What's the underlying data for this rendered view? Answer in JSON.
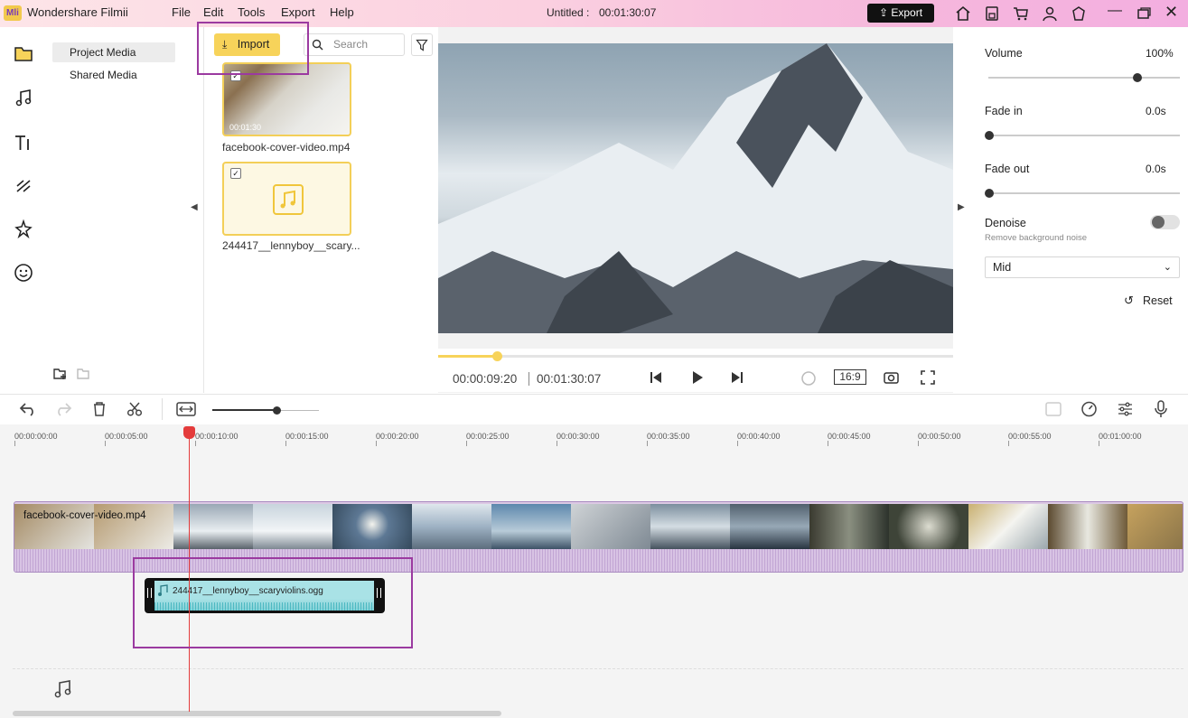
{
  "app": {
    "title": "Wondershare Filmii",
    "logo_text": "Mli"
  },
  "menu": [
    "File",
    "Edit",
    "Tools",
    "Export",
    "Help"
  ],
  "project": {
    "name": "Untitled :",
    "duration": "00:01:30:07"
  },
  "export_label": "Export",
  "sidebar": {
    "items": [
      "Project Media",
      "Shared Media"
    ]
  },
  "media": {
    "import_label": "Import",
    "search_placeholder": "Search",
    "items": [
      {
        "name": "facebook-cover-video.mp4",
        "duration": "00:01:30"
      },
      {
        "name": "244417__lennyboy__scary..."
      }
    ]
  },
  "player": {
    "current": "00:00:09:20",
    "total": "00:01:30:07",
    "aspect": "16:9",
    "progress": 0.11
  },
  "audio_panel": {
    "volume": {
      "label": "Volume",
      "value": "100%",
      "level": 0.83
    },
    "fade_in": {
      "label": "Fade in",
      "value": "0.0s"
    },
    "fade_out": {
      "label": "Fade out",
      "value": "0.0s"
    },
    "denoise": {
      "label": "Denoise",
      "sub": "Remove background noise"
    },
    "level": "Mid",
    "reset_label": "Reset"
  },
  "ruler": [
    "00:00:00:00",
    "00:00:05:00",
    "00:00:10:00",
    "00:00:15:00",
    "00:00:20:00",
    "00:00:25:00",
    "00:00:30:00",
    "00:00:35:00",
    "00:00:40:00",
    "00:00:45:00",
    "00:00:50:00",
    "00:00:55:00",
    "00:01:00:00"
  ],
  "tracks": {
    "video_clip": "facebook-cover-video.mp4",
    "audio_clip": "244417__lennyboy__scaryviolins.ogg"
  }
}
